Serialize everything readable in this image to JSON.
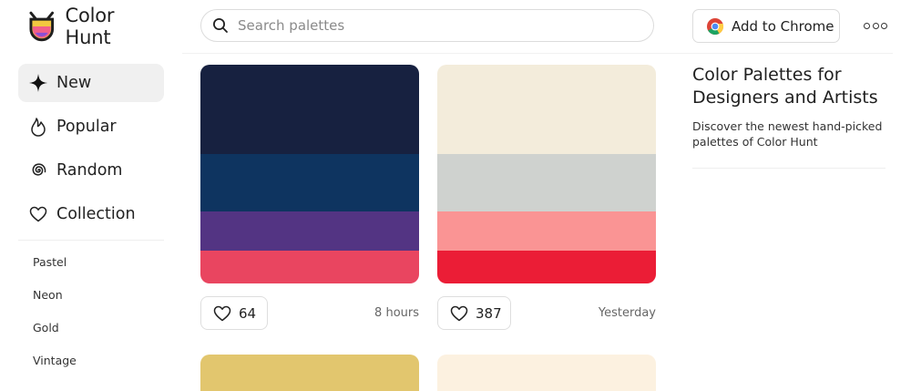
{
  "app": {
    "name": "Color Hunt"
  },
  "search": {
    "placeholder": "Search palettes"
  },
  "header": {
    "chrome_button": "Add to Chrome",
    "more_icon": "more-dots-icon"
  },
  "sidebar": {
    "items": [
      {
        "label": "New",
        "icon": "sparkle-icon",
        "active": true
      },
      {
        "label": "Popular",
        "icon": "flame-icon",
        "active": false
      },
      {
        "label": "Random",
        "icon": "spiral-icon",
        "active": false
      },
      {
        "label": "Collection",
        "icon": "heart-icon",
        "active": false
      }
    ],
    "tags": [
      "Pastel",
      "Neon",
      "Gold",
      "Vintage"
    ]
  },
  "palettes": [
    {
      "colors": [
        "#172140",
        "#0e3460",
        "#533483",
        "#e94560"
      ],
      "likes": "64",
      "time": "8 hours"
    },
    {
      "colors": [
        "#f3ecdb",
        "#cfd2cf",
        "#fa9494",
        "#eb1d36"
      ],
      "likes": "387",
      "time": "Yesterday"
    }
  ],
  "next_palettes": [
    {
      "color": "#e2c66e"
    },
    {
      "color": "#fcf1e0"
    }
  ],
  "right_panel": {
    "title": "Color Palettes for Designers and Artists",
    "description": "Discover the newest hand-picked palettes of Color Hunt"
  }
}
